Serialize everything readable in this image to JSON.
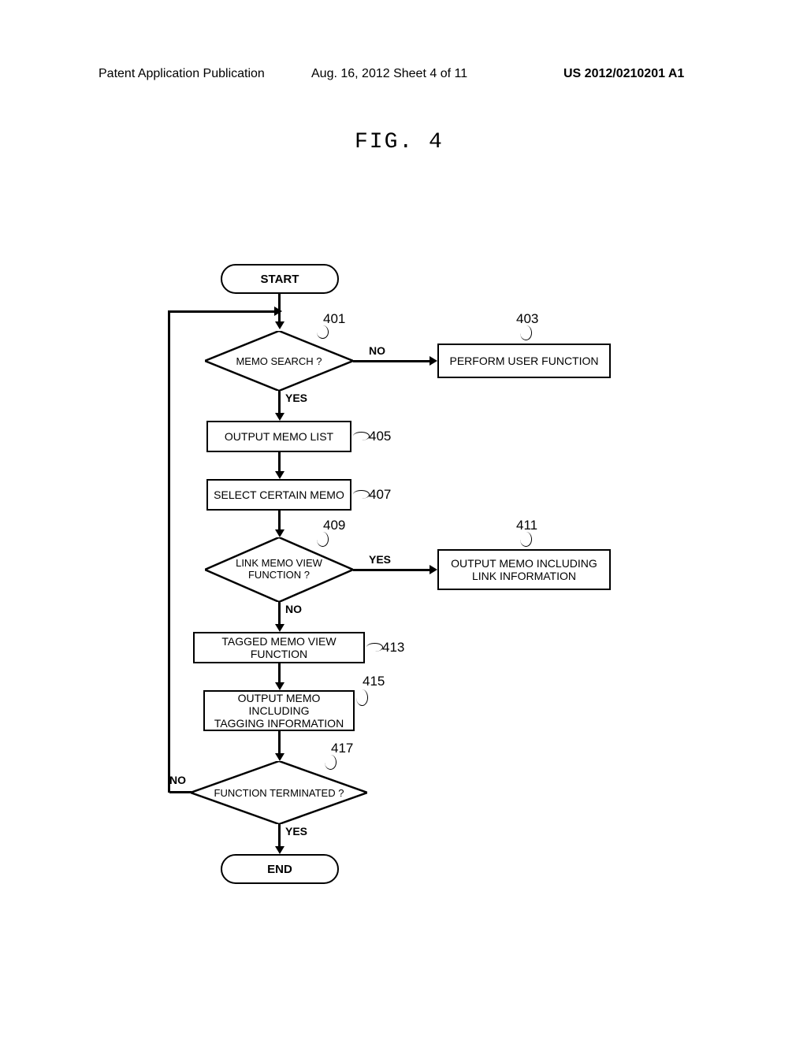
{
  "header": {
    "left": "Patent Application Publication",
    "center": "Aug. 16, 2012  Sheet 4 of 11",
    "right": "US 2012/0210201 A1"
  },
  "figure_title": "FIG. 4",
  "nodes": {
    "start": "START",
    "end": "END",
    "d401": "MEMO SEARCH ?",
    "b403": "PERFORM USER FUNCTION",
    "b405": "OUTPUT MEMO LIST",
    "b407": "SELECT CERTAIN MEMO",
    "d409": "LINK MEMO VIEW\nFUNCTION ?",
    "b411": "OUTPUT MEMO INCLUDING\nLINK INFORMATION",
    "b413": "TAGGED MEMO VIEW FUNCTION",
    "b415": "OUTPUT MEMO INCLUDING\nTAGGING INFORMATION",
    "d417": "FUNCTION TERMINATED ?"
  },
  "callouts": {
    "c401": "401",
    "c403": "403",
    "c405": "405",
    "c407": "407",
    "c409": "409",
    "c411": "411",
    "c413": "413",
    "c415": "415",
    "c417": "417"
  },
  "branches": {
    "yes": "YES",
    "no": "NO"
  }
}
